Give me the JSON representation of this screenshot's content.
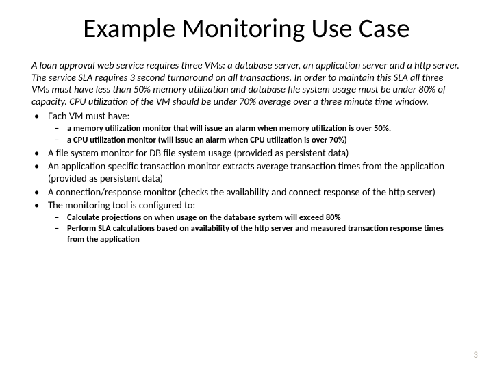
{
  "title": "Example Monitoring Use Case",
  "intro": "A  loan approval web service requires three VMs:  a database server, an application server and a http server.  The service SLA requires 3 second turnaround on all transactions.  In order to maintain this SLA all three VMs must have less than 50% memory utilization and database file system usage must be under 80% of capacity. CPU utilization of the VM should be under 70% average over a three minute time window.",
  "bullets1": {
    "b0": "Each VM must have:",
    "b1": "A file system monitor for DB file system usage (provided as persistent data)",
    "b2": "An application specific transaction monitor extracts average transaction times from the application (provided as persistent data)",
    "b3": "A connection/response monitor (checks the availability and connect response of the http server)",
    "b4": "The monitoring tool is configured to:"
  },
  "sub_a": {
    "s0": "a memory utilization monitor that will issue an alarm when memory utilization is over 50%.",
    "s1": "a CPU utilization monitor (will issue an alarm when CPU utilization is over 70%)"
  },
  "sub_b": {
    "s0": "Calculate projections on when usage on the database system will exceed 80%",
    "s1": "Perform SLA calculations based on availability of the http server and measured transaction response times from the application"
  },
  "page_number": "3"
}
